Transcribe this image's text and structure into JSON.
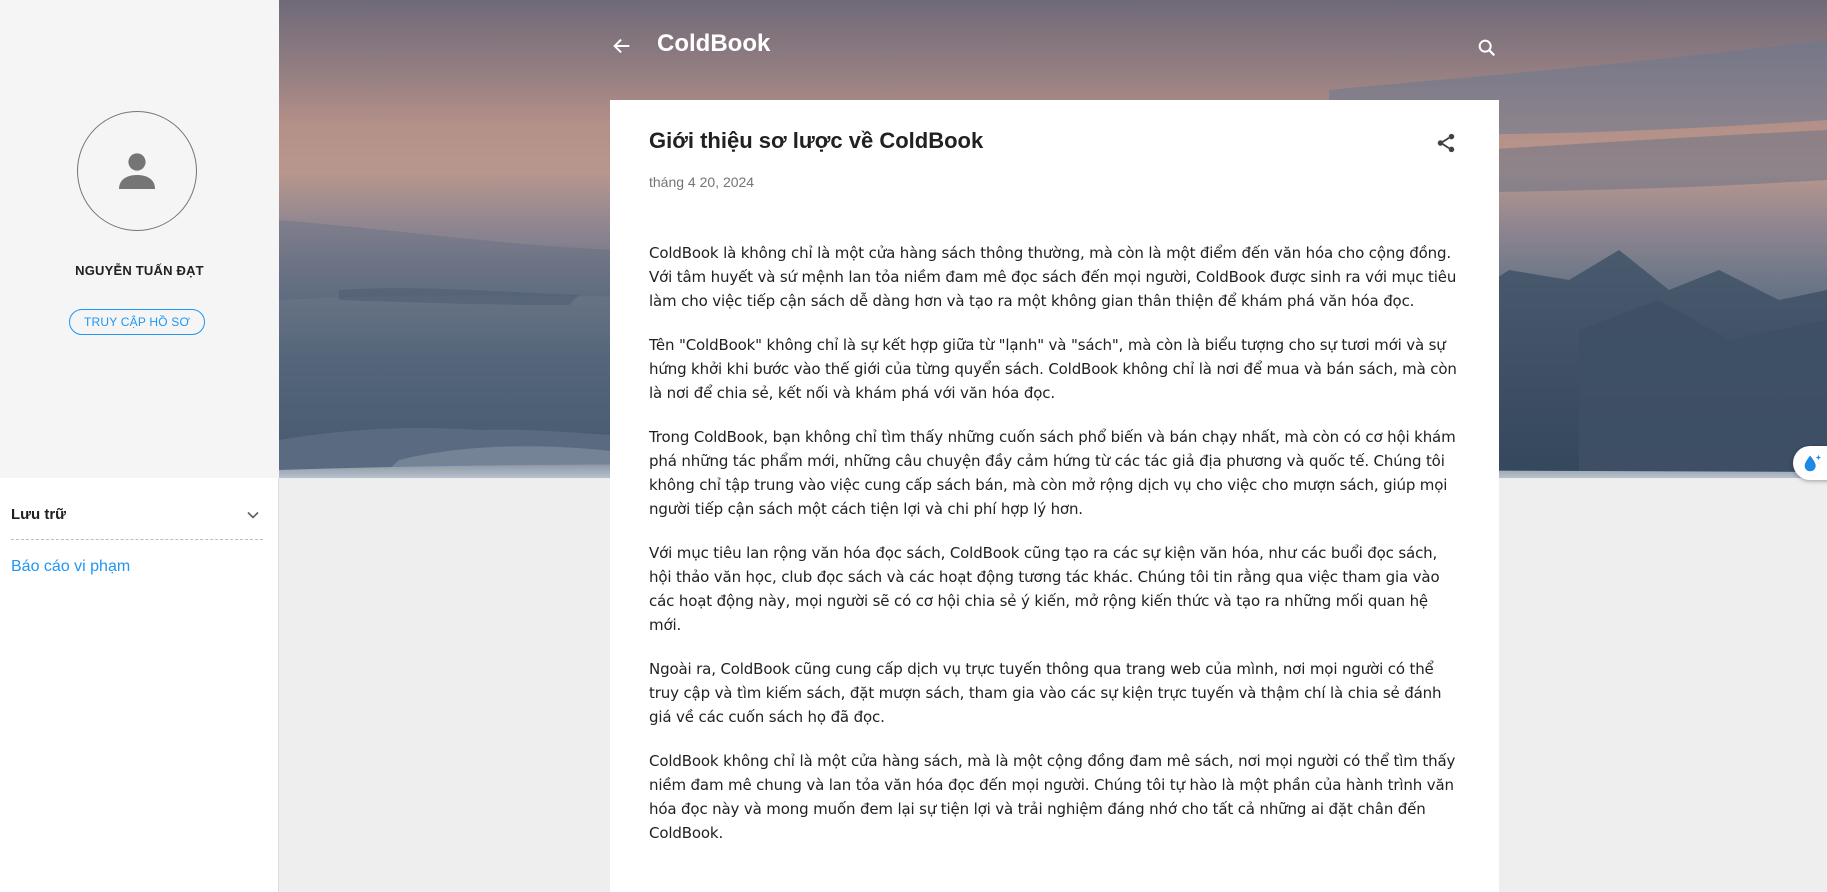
{
  "colors": {
    "accent": "#2196f3",
    "text": "#212121",
    "muted": "#757575",
    "sidebar_bg": "#f5f5f5",
    "page_bg": "#eeeeee"
  },
  "header": {
    "back_icon": "arrow-left-icon",
    "title": "ColdBook",
    "search_icon": "search-icon"
  },
  "sidebar": {
    "avatar_icon": "person-icon",
    "profile_name": "NGUYỄN TUẤN ĐẠT",
    "profile_button": "TRUY CẬP HỒ SƠ",
    "archive_title": "Lưu trữ",
    "archive_icon": "chevron-down-icon",
    "report_link": "Báo cáo vi phạm"
  },
  "post": {
    "title": "Giới thiệu sơ lược về ColdBook",
    "date": "tháng 4 20, 2024",
    "share_icon": "share-icon",
    "paragraphs": [
      "ColdBook là không chỉ là một cửa hàng sách thông thường, mà còn là một điểm đến văn hóa cho cộng đồng. Với tâm huyết và sứ mệnh lan tỏa niềm đam mê đọc sách đến mọi người, ColdBook được sinh ra với mục tiêu làm cho việc tiếp cận sách dễ dàng hơn và tạo ra một không gian thân thiện để khám phá văn hóa đọc.",
      "Tên \"ColdBook\" không chỉ là sự kết hợp giữa từ \"lạnh\" và \"sách\", mà còn là biểu tượng cho sự tươi mới và sự hứng khởi khi bước vào thế giới của từng quyển sách. ColdBook không chỉ là nơi để mua và bán sách, mà còn là nơi để chia sẻ, kết nối và khám phá với văn hóa đọc.",
      "Trong ColdBook, bạn không chỉ tìm thấy những cuốn sách phổ biến và bán chạy nhất, mà còn có cơ hội khám phá những tác phẩm mới, những câu chuyện đầy cảm hứng từ các tác giả địa phương và quốc tế. Chúng tôi không chỉ tập trung vào việc cung cấp sách bán, mà còn mở rộng dịch vụ cho việc cho mượn sách, giúp mọi người tiếp cận sách một cách tiện lợi và chi phí hợp lý hơn.",
      "Với mục tiêu lan rộng văn hóa đọc sách, ColdBook cũng tạo ra các sự kiện văn hóa, như các buổi đọc sách, hội thảo văn học, club đọc sách và các hoạt động tương tác khác. Chúng tôi tin rằng qua việc tham gia vào các hoạt động này, mọi người sẽ có cơ hội chia sẻ ý kiến, mở rộng kiến thức và tạo ra những mối quan hệ mới.",
      "Ngoài ra, ColdBook cũng cung cấp dịch vụ trực tuyến thông qua trang web của mình, nơi mọi người có thể truy cập và tìm kiếm sách, đặt mượn sách, tham gia vào các sự kiện trực tuyến và thậm chí là chia sẻ đánh giá về các cuốn sách họ đã đọc.",
      "ColdBook không chỉ là một cửa hàng sách, mà là một cộng đồng đam mê sách, nơi mọi người có thể tìm thấy niềm đam mê chung và lan tỏa văn hóa đọc đến mọi người. Chúng tôi tự hào là một phần của hành trình văn hóa đọc này và mong muốn đem lại sự tiện lợi và trải nghiệm đáng nhớ cho tất cả những ai đặt chân đến ColdBook."
    ]
  },
  "widget": {
    "icon": "water-drop-sparkle-icon"
  }
}
